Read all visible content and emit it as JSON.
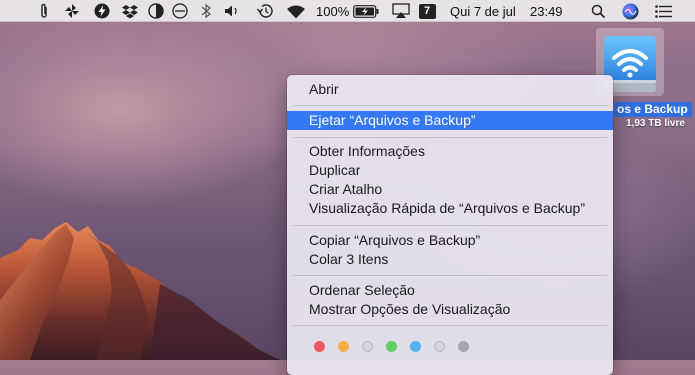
{
  "menubar": {
    "battery_percent": "100%",
    "input_source": "7",
    "date": "Qui 7 de jul",
    "time": "23:49"
  },
  "desktop": {
    "drive_label": "os e Backup",
    "drive_free": "1,93 TB livre"
  },
  "context_menu": {
    "items": [
      {
        "label": "Abrir"
      },
      {
        "label": "Ejetar “Arquivos e Backup”",
        "highlighted": true
      },
      {
        "label": "Obter Informações"
      },
      {
        "label": "Duplicar"
      },
      {
        "label": "Criar Atalho"
      },
      {
        "label": "Visualização Rápida de “Arquivos e Backup”"
      },
      {
        "label": "Copiar “Arquivos e Backup”"
      },
      {
        "label": "Colar 3 Itens"
      },
      {
        "label": "Ordenar Seleção"
      },
      {
        "label": "Mostrar Opções de Visualização"
      }
    ],
    "tag_colors": [
      "#ec5a5e",
      "#f3ae4a",
      "#d8d4dc",
      "#5fcf66",
      "#52b3ee",
      "#d8d4dc",
      "#a8a6ac"
    ]
  },
  "colors": {
    "highlight": "#3478f6",
    "selection_label": "#2f6fde"
  }
}
